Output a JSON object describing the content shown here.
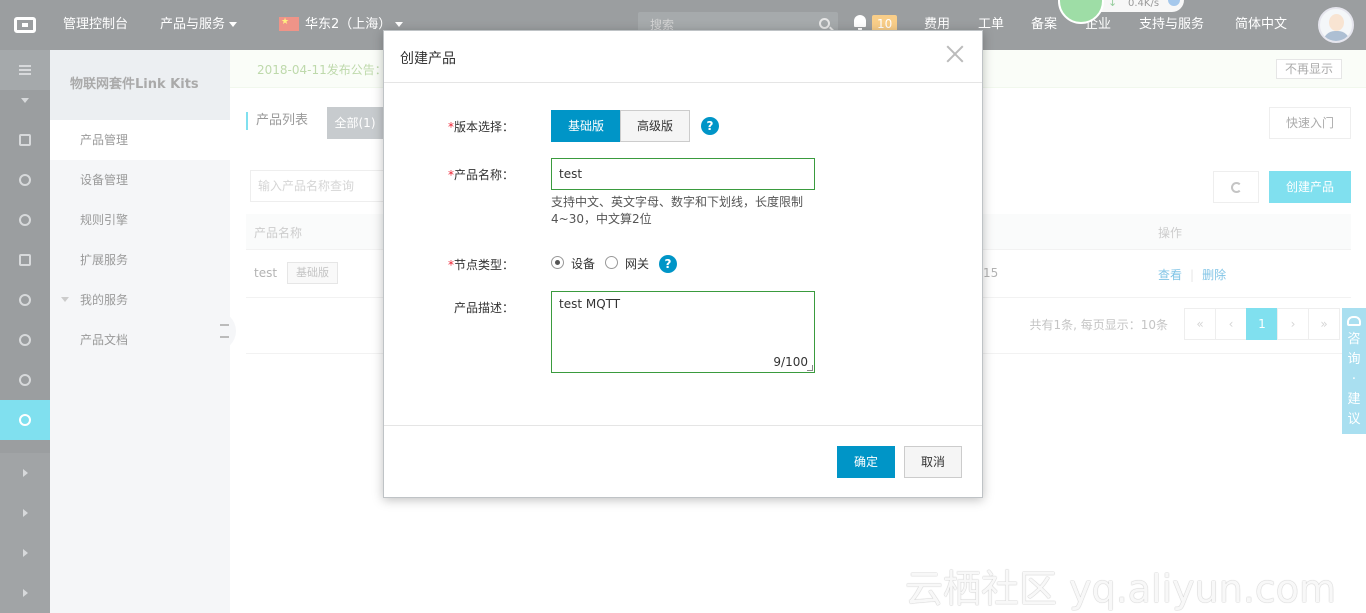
{
  "topbar": {
    "console": "管理控制台",
    "products": "产品与服务",
    "region": "华东2（上海）",
    "search_placeholder": "搜索",
    "notification_count": "10",
    "billing": "费用",
    "ticket": "工单",
    "icp": "备案",
    "enterprise": "企业",
    "support": "支持与服务",
    "language": "简体中文",
    "net_speed": "0.4K/s"
  },
  "sidebar": {
    "title": "物联网套件Link Kits",
    "items": [
      {
        "label": "产品管理"
      },
      {
        "label": "设备管理"
      },
      {
        "label": "规则引擎"
      },
      {
        "label": "扩展服务"
      },
      {
        "label": "我的服务"
      },
      {
        "label": "产品文档"
      }
    ]
  },
  "notice": {
    "text": "2018-04-11发布公告：",
    "dismiss": "不再显示"
  },
  "main": {
    "list_title": "产品列表",
    "tab_all": "全部(1)",
    "quick_start": "快速入门",
    "search_placeholder": "输入产品名称查询",
    "create_product": "创建产品",
    "columns": {
      "name": "产品名称",
      "actions": "操作"
    },
    "rows": [
      {
        "name": "test",
        "edition": "基础版",
        "partial_value": "15",
        "view": "查看",
        "delete": "删除"
      }
    ],
    "pagination": {
      "summary": "共有1条, 每页显示：10条",
      "first": "«",
      "prev": "‹",
      "current": "1",
      "next": "›",
      "last": "»"
    }
  },
  "feedback": {
    "chars": [
      "咨",
      "询",
      "·",
      "建",
      "议"
    ]
  },
  "watermark": "云栖社区 yq.aliyun.com",
  "modal": {
    "title": "创建产品",
    "edition_label": "版本选择：",
    "edition_basic": "基础版",
    "edition_advanced": "高级版",
    "name_label": "产品名称：",
    "name_value": "test",
    "name_hint": "支持中文、英文字母、数字和下划线，长度限制4~30，中文算2位",
    "node_label": "节点类型：",
    "node_device": "设备",
    "node_gateway": "网关",
    "node_selected": "设备",
    "desc_label": "产品描述：",
    "desc_value": "test MQTT",
    "desc_counter": "9/100",
    "required_mark": "*",
    "help_glyph": "?",
    "ok": "确定",
    "cancel": "取消"
  }
}
